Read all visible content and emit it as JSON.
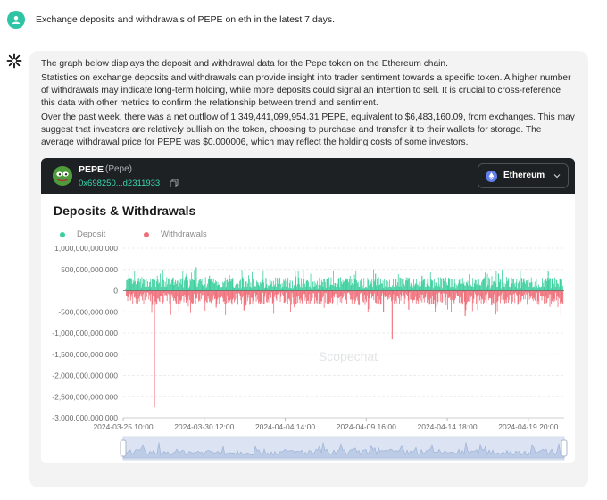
{
  "user": {
    "question": "Exchange deposits and withdrawals of PEPE on eth in the latest 7 days."
  },
  "answer": {
    "p1": "The graph below displays the deposit and withdrawal data for the Pepe token on the Ethereum chain.",
    "p2": "Statistics on exchange deposits and withdrawals can provide insight into trader sentiment towards a specific token. A higher number of withdrawals may indicate long-term holding, while more deposits could signal an intention to sell. It is crucial to cross-reference this data with other metrics to confirm the relationship between trend and sentiment.",
    "p3": "Over the past week, there was a net outflow of 1,349,441,099,954.31 PEPE, equivalent to $6,483,160.09, from exchanges. This may suggest that investors are relatively bullish on the token, choosing to purchase and transfer it to their wallets for storage. The average withdrawal price for PEPE was $0.000006, which may reflect the holding costs of some investors."
  },
  "token": {
    "symbol": "PEPE",
    "name": "(Pepe)",
    "address": "0x698250...d2311933",
    "chain": "Ethereum",
    "icons": [
      "pepe-logo",
      "copy-icon",
      "ethereum-icon",
      "chevron-down-icon"
    ]
  },
  "colors": {
    "deposit": "#3ccf9e",
    "withdrawal": "#ef6d78",
    "accent": "#2fc4a4"
  },
  "chart_data": {
    "type": "bar",
    "title": "Deposits & Withdrawals",
    "watermark": "Scopechat",
    "legend": [
      "Deposit",
      "Withdrawals"
    ],
    "legend_position": "top-left",
    "grid": true,
    "y_ticks": [
      "1,000,000,000,000",
      "500,000,000,000",
      "0",
      "-500,000,000,000",
      "-1,000,000,000,000",
      "-1,500,000,000,000",
      "-2,000,000,000,000",
      "-2,500,000,000,000",
      "-3,000,000,000,000"
    ],
    "ylim": [
      -3000000000000,
      1000000000000
    ],
    "x_ticks": [
      "2024-03-25 10:00",
      "2024-03-30 12:00",
      "2024-04-04 14:00",
      "2024-04-09 16:00",
      "2024-04-14 18:00",
      "2024-04-19 20:00"
    ],
    "x_range_hours": [
      0,
      664
    ],
    "x_tick_hours": [
      0,
      122,
      244,
      366,
      488,
      610
    ],
    "series": [
      {
        "name": "Deposit",
        "points": [
          [
            12,
            150000000000.0
          ],
          [
            40,
            200000000000.0
          ],
          [
            75,
            300000000000.0
          ],
          [
            110,
            550000000000.0
          ],
          [
            130,
            350000000000.0
          ],
          [
            165,
            300000000000.0
          ],
          [
            215,
            300000000000.0
          ],
          [
            260,
            250000000000.0
          ],
          [
            300,
            200000000000.0
          ],
          [
            335,
            250000000000.0
          ],
          [
            380,
            400000000000.0
          ],
          [
            418,
            300000000000.0
          ],
          [
            450,
            350000000000.0
          ],
          [
            490,
            300000000000.0
          ],
          [
            530,
            250000000000.0
          ],
          [
            565,
            400000000000.0
          ],
          [
            600,
            300000000000.0
          ],
          [
            640,
            450000000000.0
          ]
        ]
      },
      {
        "name": "Withdrawals",
        "points": [
          [
            20,
            -300000000000.0
          ],
          [
            47,
            -2750000000000.0
          ],
          [
            70,
            -300000000000.0
          ],
          [
            95,
            -250000000000.0
          ],
          [
            140,
            -400000000000.0
          ],
          [
            185,
            -350000000000.0
          ],
          [
            225,
            -300000000000.0
          ],
          [
            270,
            -250000000000.0
          ],
          [
            315,
            -300000000000.0
          ],
          [
            355,
            -350000000000.0
          ],
          [
            392,
            -500000000000.0
          ],
          [
            405,
            -1150000000000.0
          ],
          [
            430,
            -450000000000.0
          ],
          [
            470,
            -400000000000.0
          ],
          [
            515,
            -600000000000.0
          ],
          [
            555,
            -350000000000.0
          ],
          [
            595,
            -300000000000.0
          ],
          [
            645,
            -250000000000.0
          ]
        ]
      }
    ]
  }
}
